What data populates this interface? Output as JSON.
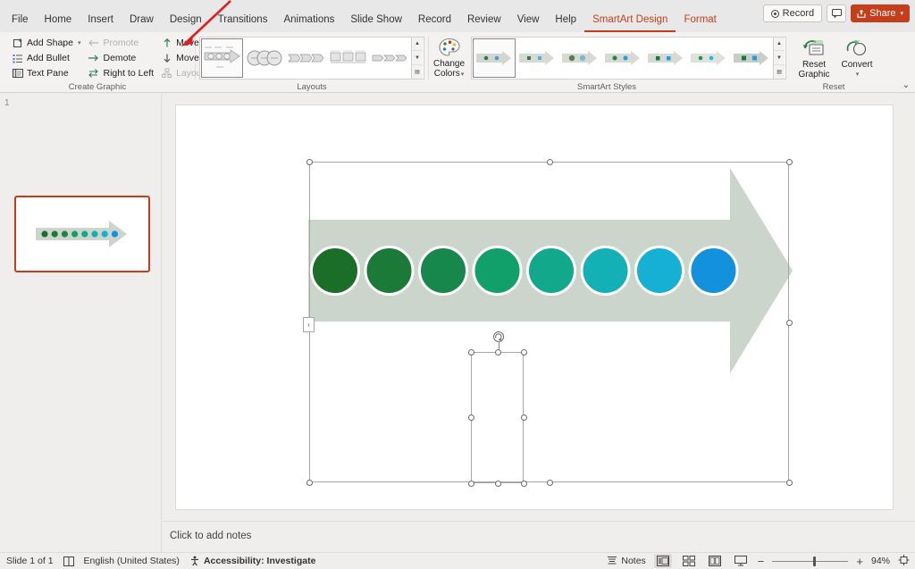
{
  "window": {
    "tabs": [
      {
        "label": "File",
        "state": "normal"
      },
      {
        "label": "Home",
        "state": "normal"
      },
      {
        "label": "Insert",
        "state": "normal"
      },
      {
        "label": "Draw",
        "state": "normal"
      },
      {
        "label": "Design",
        "state": "normal"
      },
      {
        "label": "Transitions",
        "state": "normal"
      },
      {
        "label": "Animations",
        "state": "normal"
      },
      {
        "label": "Slide Show",
        "state": "normal"
      },
      {
        "label": "Record",
        "state": "normal"
      },
      {
        "label": "Review",
        "state": "normal"
      },
      {
        "label": "View",
        "state": "normal"
      },
      {
        "label": "Help",
        "state": "normal"
      },
      {
        "label": "SmartArt Design",
        "state": "active"
      },
      {
        "label": "Format",
        "state": "contextual"
      }
    ],
    "record_button": "Record",
    "share_button": "Share",
    "comment_icon": "comment-icon",
    "accent_color": "#c43e1c"
  },
  "ribbon": {
    "create_graphic": {
      "label": "Create Graphic",
      "items": [
        {
          "label": "Add Shape",
          "icon": "add-shape-icon",
          "enabled": true,
          "dropdown": true
        },
        {
          "label": "Add Bullet",
          "icon": "add-bullet-icon",
          "enabled": true,
          "dropdown": false
        },
        {
          "label": "Text Pane",
          "icon": "text-pane-icon",
          "enabled": true,
          "dropdown": false
        },
        {
          "label": "Promote",
          "icon": "promote-icon",
          "enabled": false,
          "dropdown": false
        },
        {
          "label": "Demote",
          "icon": "demote-icon",
          "enabled": true,
          "dropdown": false
        },
        {
          "label": "Right to Left",
          "icon": "right-to-left-icon",
          "enabled": true,
          "dropdown": false
        },
        {
          "label": "Move Up",
          "icon": "move-up-icon",
          "enabled": true,
          "dropdown": false
        },
        {
          "label": "Move Down",
          "icon": "move-down-icon",
          "enabled": true,
          "dropdown": false
        },
        {
          "label": "Layout",
          "icon": "layout-icon",
          "enabled": false,
          "dropdown": true
        }
      ]
    },
    "layouts": {
      "label": "Layouts",
      "selected_index": 0,
      "thumbnails": [
        "basic-process-arrow",
        "continuous-block-circles",
        "chevron-process",
        "box-process",
        "basic-chevron-process"
      ],
      "scroll_up_icon": "scroll-up-icon",
      "scroll_down_icon": "scroll-down-icon",
      "more_icon": "more-icon"
    },
    "smartart_styles": {
      "label": "SmartArt Styles",
      "change_colors_label_line1": "Change",
      "change_colors_label_line2": "Colors",
      "change_colors_icon": "palette-icon",
      "selected_index": 0,
      "thumbnail_count": 7,
      "scroll_up_icon": "scroll-up-icon",
      "scroll_down_icon": "scroll-down-icon",
      "more_icon": "more-icon"
    },
    "reset": {
      "label": "Reset",
      "reset_graphic_line1": "Reset",
      "reset_graphic_line2": "Graphic",
      "reset_graphic_icon": "reset-graphic-icon",
      "convert_label": "Convert",
      "convert_icon": "convert-icon"
    },
    "collapse_icon": "chevron-down-icon"
  },
  "thumbnail_pane": {
    "slide_number": "1",
    "selected": true
  },
  "slide": {
    "smartart": {
      "type": "basic-process-arrow",
      "arrow_color": "#ccd5cb",
      "circle_count": 8,
      "circle_colors": [
        "#1a6e27",
        "#1c7a38",
        "#18874c",
        "#12a06a",
        "#12a88c",
        "#13b0b6",
        "#16b0d4",
        "#1491dd"
      ],
      "selection": {
        "outer_handles": 8,
        "inner_handles": 8,
        "rotation_handle_icon": "rotate-icon",
        "text_pane_toggle_icon": "chevron-left-icon"
      }
    }
  },
  "notes": {
    "placeholder": "Click to add notes"
  },
  "statusbar": {
    "slide_count": "Slide 1 of 1",
    "notes_icon_label": "notes-page-icon",
    "language": "English (United States)",
    "accessibility_icon": "accessibility-icon",
    "accessibility": "Accessibility: Investigate",
    "notes_button": "Notes",
    "view_buttons": [
      {
        "name": "normal-view",
        "active": true
      },
      {
        "name": "slide-sorter-view",
        "active": false
      },
      {
        "name": "reading-view",
        "active": false
      },
      {
        "name": "slide-show-view",
        "active": false
      }
    ],
    "zoom_out": "−",
    "zoom_in": "+",
    "zoom_level": "94%",
    "fit_slide_icon": "fit-to-window-icon"
  },
  "annotation": {
    "arrow_color": "#e02020",
    "points_to": "Move Up"
  }
}
